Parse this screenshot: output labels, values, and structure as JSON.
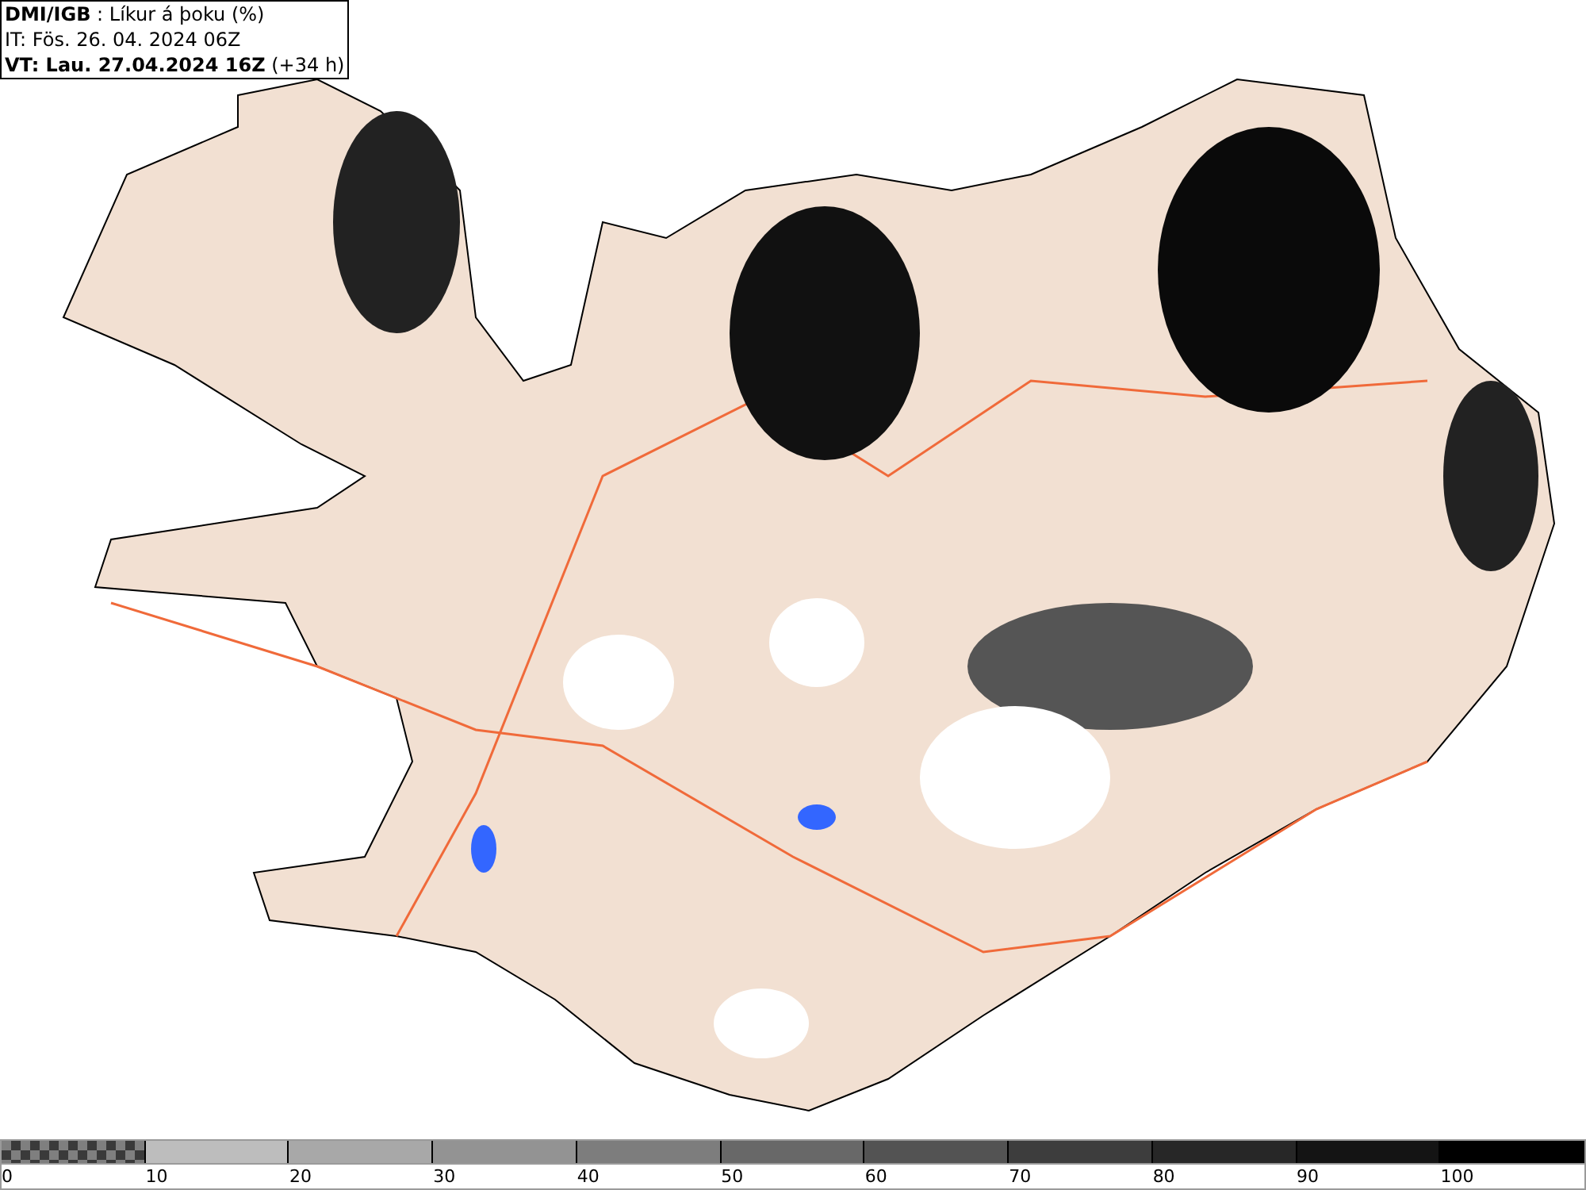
{
  "header": {
    "lines": [
      "**DMI/IGB** : Líkur á þoku (%)",
      "IT: Fös. 26. 04. 2024 06Z",
      "**VT: Lau. 27.04.2024 16Z** (+34 h)"
    ]
  },
  "legend": {
    "bins": [
      {
        "kind": "checker",
        "color": "#7f7f7f"
      },
      {
        "kind": "solid",
        "color": "#bdbdbd"
      },
      {
        "kind": "solid",
        "color": "#a8a8a8"
      },
      {
        "kind": "solid",
        "color": "#939393"
      },
      {
        "kind": "solid",
        "color": "#7d7d7d"
      },
      {
        "kind": "solid",
        "color": "#686868"
      },
      {
        "kind": "solid",
        "color": "#535353"
      },
      {
        "kind": "solid",
        "color": "#3d3d3d"
      },
      {
        "kind": "solid",
        "color": "#272727"
      },
      {
        "kind": "solid",
        "color": "#141414"
      },
      {
        "kind": "solid",
        "color": "#000000"
      }
    ],
    "labels": [
      "0",
      "10",
      "20",
      "30",
      "40",
      "50",
      "60",
      "70",
      "80",
      "90",
      "100"
    ]
  }
}
